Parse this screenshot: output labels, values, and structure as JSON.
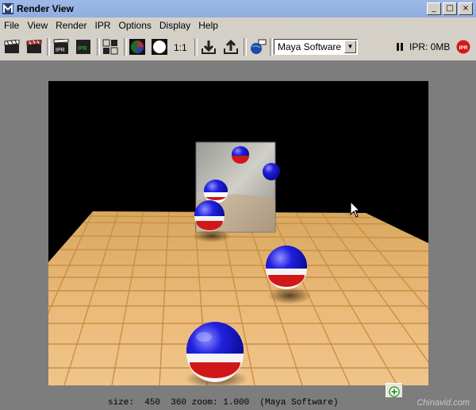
{
  "window": {
    "title": "Render View"
  },
  "menu": [
    "File",
    "View",
    "Render",
    "IPR",
    "Options",
    "Display",
    "Help"
  ],
  "toolbar": {
    "zoom_label": "1:1",
    "renderer": "Maya Software",
    "ipr_status": "IPR: 0MB",
    "ipr_badge": "IPR",
    "buttons": [
      {
        "name": "render-clapper-icon",
        "icon": "clapperboard"
      },
      {
        "name": "rerender-clapper-icon",
        "icon": "clapperboard-red"
      },
      {
        "name": "ipr-render-icon",
        "icon": "ipr-clapper",
        "label": "IPR"
      },
      {
        "name": "ipr-refresh-icon",
        "icon": "ipr-green",
        "label": "IPR"
      },
      {
        "name": "render-region-icon",
        "icon": "region-clapper"
      },
      {
        "name": "color-channels-icon",
        "icon": "rgb-circle"
      },
      {
        "name": "alpha-channel-icon",
        "icon": "white-circle"
      },
      {
        "name": "keep-image-icon",
        "icon": "down-arrow"
      },
      {
        "name": "remove-image-icon",
        "icon": "up-arrow"
      },
      {
        "name": "render-settings-icon",
        "icon": "settings-globe"
      }
    ]
  },
  "status": {
    "text": "size:  450  360 zoom: 1.000  (Maya Software)",
    "watermark": "Chinavid.com"
  }
}
